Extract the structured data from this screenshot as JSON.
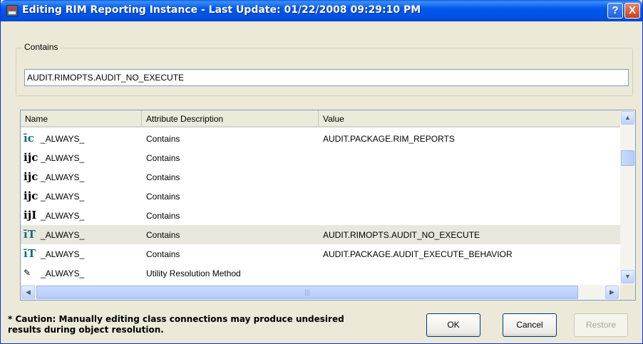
{
  "window": {
    "title": "Editing RIM Reporting Instance - Last Update: 01/22/2008 09:29:10 PM",
    "help_label": "?",
    "close_label": "X"
  },
  "contains": {
    "group_label": "Contains",
    "value": "AUDIT.RIMOPTS.AUDIT_NO_EXECUTE"
  },
  "table": {
    "columns": [
      "Name",
      "Attribute Description",
      "Value"
    ],
    "rows": [
      {
        "icon": "teal-bracket-c-icon",
        "glyph": "īc",
        "name": "_ALWAYS_",
        "desc": "Contains",
        "value": "AUDIT.PACKAGE.RIM_REPORTS"
      },
      {
        "icon": "bracket-c-icon",
        "glyph": "ĳc",
        "name": "_ALWAYS_",
        "desc": "Contains",
        "value": ""
      },
      {
        "icon": "bracket-c-icon",
        "glyph": "ĳc",
        "name": "_ALWAYS_",
        "desc": "Contains",
        "value": ""
      },
      {
        "icon": "bracket-c-icon",
        "glyph": "ĳc",
        "name": "_ALWAYS_",
        "desc": "Contains",
        "value": ""
      },
      {
        "icon": "bracket-i-icon",
        "glyph": "ĳI",
        "name": "_ALWAYS_",
        "desc": "Contains",
        "value": ""
      },
      {
        "icon": "teal-bracket-t-icon",
        "glyph": "īT",
        "name": "_ALWAYS_",
        "desc": "Contains",
        "value": "AUDIT.RIMOPTS.AUDIT_NO_EXECUTE"
      },
      {
        "icon": "teal-bracket-t-icon",
        "glyph": "īT",
        "name": "_ALWAYS_",
        "desc": "Contains",
        "value": "AUDIT.PACKAGE.AUDIT_EXECUTE_BEHAVIOR"
      },
      {
        "icon": "pen-icon",
        "glyph": "✎",
        "name": "_ALWAYS_",
        "desc": "Utility Resolution Method",
        "value": ""
      }
    ],
    "selected_row": 5
  },
  "footer": {
    "caution": "* Caution: Manually editing class connections may produce undesired results during object resolution.",
    "ok_label": "OK",
    "cancel_label": "Cancel",
    "restore_label": "Restore"
  }
}
